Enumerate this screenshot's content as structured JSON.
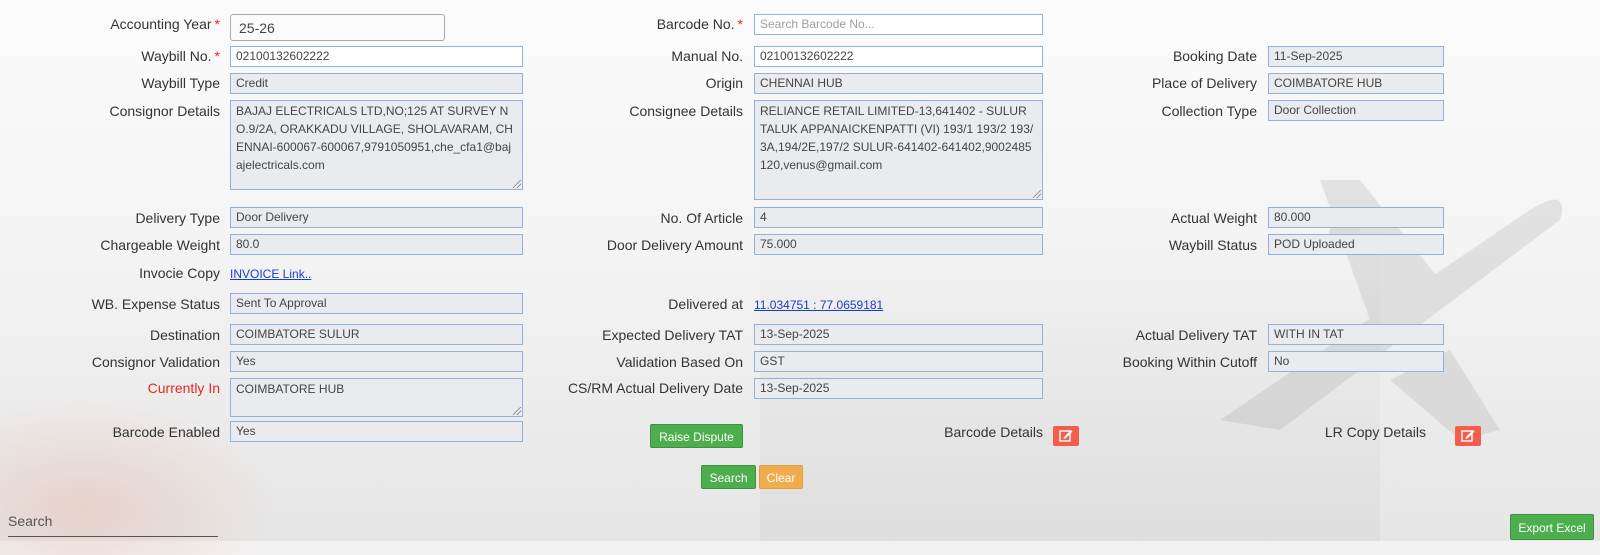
{
  "form": {
    "accounting_year": {
      "label": "Accounting Year",
      "value": "25-26"
    },
    "barcode_no": {
      "label": "Barcode No.",
      "placeholder": "Search Barcode No..."
    },
    "waybill_no": {
      "label": "Waybill No.",
      "value": "02100132602222"
    },
    "manual_no": {
      "label": "Manual No.",
      "value": "02100132602222"
    },
    "booking_date": {
      "label": "Booking Date",
      "value": "11-Sep-2025"
    },
    "waybill_type": {
      "label": "Waybill Type",
      "value": "Credit"
    },
    "origin": {
      "label": "Origin",
      "value": "CHENNAI HUB"
    },
    "place_of_delivery": {
      "label": "Place of Delivery",
      "value": "COIMBATORE HUB"
    },
    "consignor_details": {
      "label": "Consignor Details",
      "value": "BAJAJ ELECTRICALS LTD,NO;125 AT SURVEY NO.9/2A, ORAKKADU VILLAGE, SHOLAVARAM, CHENNAI-600067-600067,9791050951,che_cfa1@bajajelectricals.com"
    },
    "consignee_details": {
      "label": "Consignee Details",
      "value": "RELIANCE RETAIL LIMITED-13,641402 - SULUR TALUK APPANAICKENPATTI (VI) 193/1 193/2 193/3A,194/2E,197/2 SULUR-641402-641402,9002485120,venus@gmail.com"
    },
    "collection_type": {
      "label": "Collection Type",
      "value": "Door Collection"
    },
    "delivery_type": {
      "label": "Delivery Type",
      "value": "Door Delivery"
    },
    "no_of_article": {
      "label": "No. Of Article",
      "value": "4"
    },
    "actual_weight": {
      "label": "Actual Weight",
      "value": "80.000"
    },
    "chargeable_weight": {
      "label": "Chargeable Weight",
      "value": "80.0"
    },
    "door_delivery_amount": {
      "label": "Door Delivery Amount",
      "value": "75.000"
    },
    "waybill_status": {
      "label": "Waybill Status",
      "value": "POD Uploaded"
    },
    "invoice_copy": {
      "label": "Invocie Copy",
      "link": "INVOICE Link.."
    },
    "wb_expense_status": {
      "label": "WB. Expense Status",
      "value": "Sent To Approval"
    },
    "delivered_at": {
      "label": "Delivered at",
      "link": "11.034751 : 77.0659181"
    },
    "destination": {
      "label": "Destination",
      "value": "COIMBATORE SULUR"
    },
    "expected_delivery_tat": {
      "label": "Expected Delivery TAT",
      "value": "13-Sep-2025"
    },
    "actual_delivery_tat": {
      "label": "Actual Delivery TAT",
      "value": "WITH IN TAT"
    },
    "consignor_validation": {
      "label": "Consignor Validation",
      "value": "Yes"
    },
    "validation_based_on": {
      "label": "Validation Based On",
      "value": "GST"
    },
    "booking_within_cutoff": {
      "label": "Booking Within Cutoff",
      "value": "No"
    },
    "currently_in": {
      "label": "Currently In",
      "value": "COIMBATORE HUB"
    },
    "cs_rm_actual_delivery_date": {
      "label": "CS/RM Actual Delivery Date",
      "value": "13-Sep-2025"
    },
    "barcode_enabled": {
      "label": "Barcode Enabled",
      "value": "Yes"
    },
    "barcode_details": {
      "label": "Barcode Details"
    },
    "lr_copy_details": {
      "label": "LR Copy Details"
    }
  },
  "buttons": {
    "raise_dispute": "Raise Dispute",
    "search": "Search",
    "clear": "Clear",
    "export_excel": "Export Excel"
  },
  "grid": {
    "search_label": "Search"
  },
  "icons": {
    "edit": "edit-icon"
  },
  "colors": {
    "required": "#e8281e",
    "button_green": "#4cae4c",
    "button_orange": "#f0ad4e",
    "icon_button": "#f25e4c",
    "link": "#1a3cc9",
    "field_border": "#8fb3d6"
  }
}
